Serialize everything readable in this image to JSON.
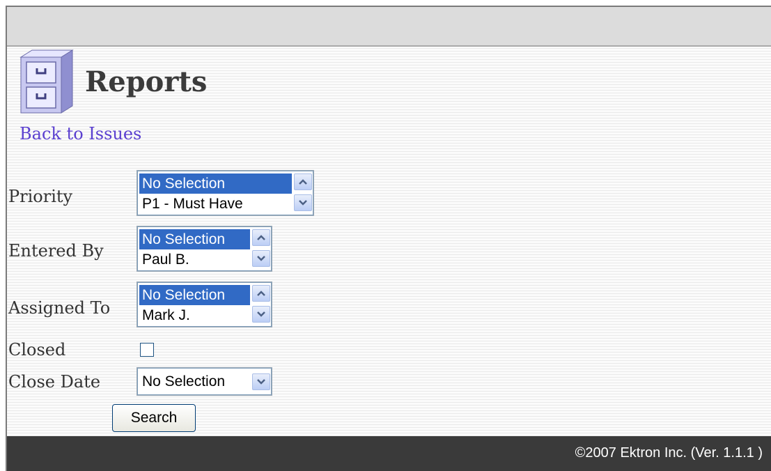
{
  "header": {
    "title": "Reports"
  },
  "nav": {
    "back_link": "Back to Issues"
  },
  "filters": {
    "priority": {
      "label": "Priority",
      "options": [
        "No Selection",
        "P1 - Must Have"
      ],
      "selected": "No Selection"
    },
    "entered_by": {
      "label": "Entered By",
      "options": [
        "No Selection",
        "Paul B."
      ],
      "selected": "No Selection"
    },
    "assigned_to": {
      "label": "Assigned To",
      "options": [
        "No Selection",
        "Mark J."
      ],
      "selected": "No Selection"
    },
    "closed": {
      "label": "Closed",
      "checked": false
    },
    "close_date": {
      "label": "Close Date",
      "value": "No Selection"
    }
  },
  "actions": {
    "search_label": "Search"
  },
  "footer": {
    "copyright": "©2007 Ektron Inc. (Ver. 1.1.1 )"
  },
  "icons": {
    "header": "file-cabinet-icon",
    "scroll_up": "chevron-up-icon",
    "scroll_down": "chevron-down-icon"
  },
  "colors": {
    "selection": "#316ac5",
    "link": "#5a3fd0",
    "footer_bg": "#3a3a3a"
  }
}
